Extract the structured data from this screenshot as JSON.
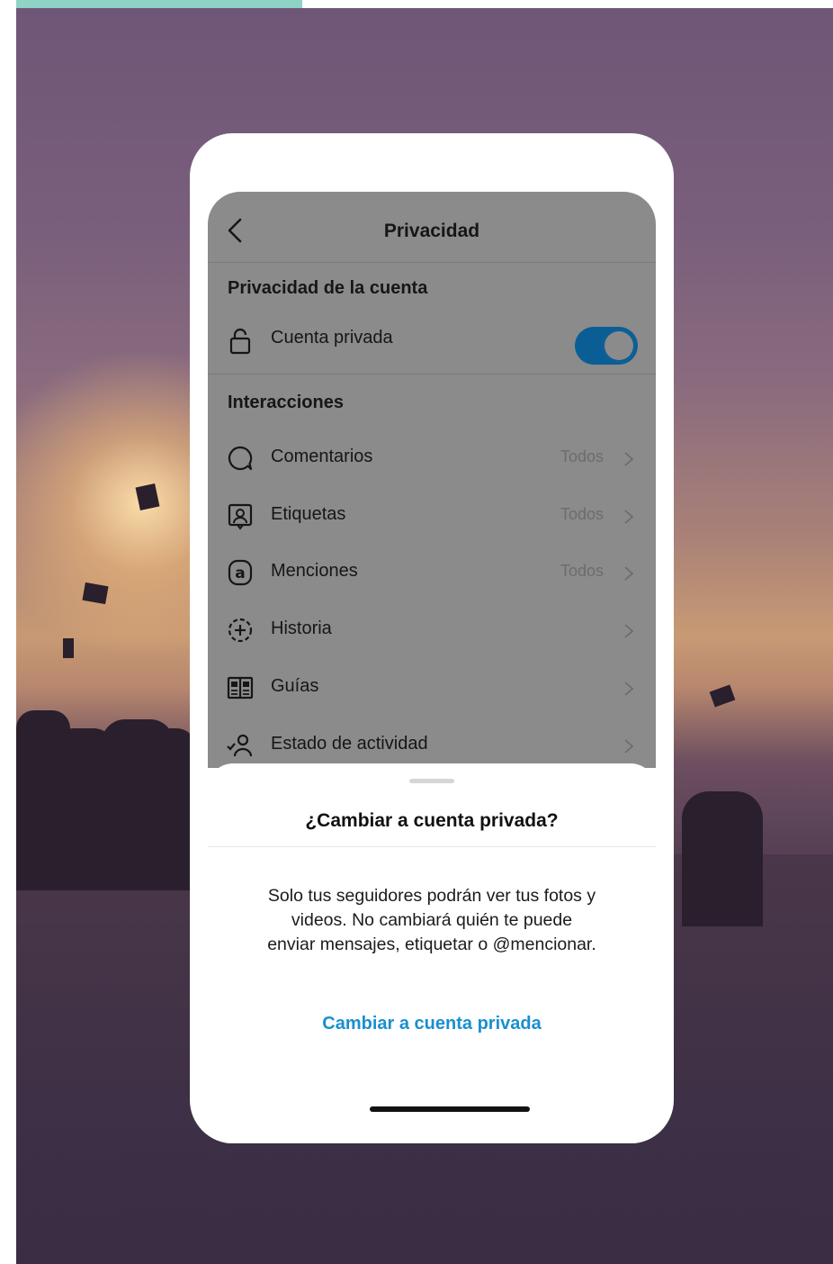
{
  "header": {
    "title": "Privacidad"
  },
  "account_privacy": {
    "section_title": "Privacidad de la cuenta",
    "private_account": {
      "label": "Cuenta privada",
      "toggle_on": true
    }
  },
  "interactions": {
    "section_title": "Interacciones",
    "items": [
      {
        "label": "Comentarios",
        "value": "Todos",
        "icon": "comment-icon"
      },
      {
        "label": "Etiquetas",
        "value": "Todos",
        "icon": "tag-person-icon"
      },
      {
        "label": "Menciones",
        "value": "Todos",
        "icon": "at-mention-icon"
      },
      {
        "label": "Historia",
        "value": "",
        "icon": "story-add-icon"
      },
      {
        "label": "Guías",
        "value": "",
        "icon": "guide-book-icon"
      },
      {
        "label": "Estado de actividad",
        "value": "",
        "icon": "activity-status-icon"
      }
    ]
  },
  "sheet": {
    "title": "¿Cambiar a cuenta privada?",
    "body": "Solo tus seguidores podrán ver tus fotos y videos. No cambiará quién te puede enviar mensajes, etiquetar o @mencionar.",
    "action": "Cambiar a cuenta privada"
  },
  "colors": {
    "toggle_on": "#0a5e95",
    "action_link": "#1a8fd0",
    "accent_strip": "#8fd3c6"
  }
}
